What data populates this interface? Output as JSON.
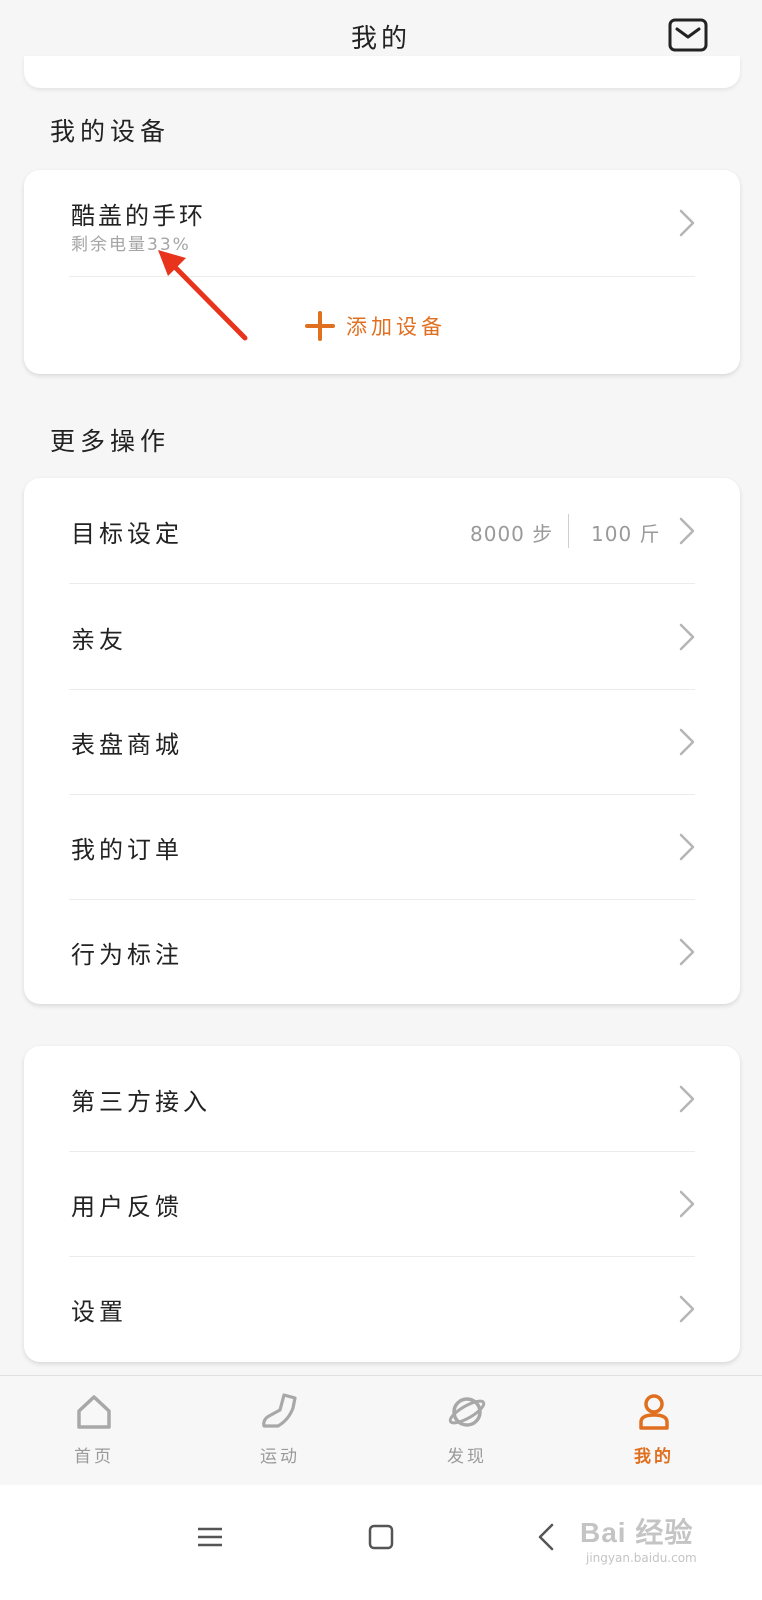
{
  "header": {
    "title": "我的",
    "mail_icon": "mail-icon"
  },
  "device_section": {
    "title": "我的设备",
    "device": {
      "name": "酷盖的手环",
      "battery_label": "剩余电量33%"
    },
    "add_label": "添加设备",
    "accent_color": "#e07020"
  },
  "more_section": {
    "title": "更多操作",
    "rows": [
      {
        "label": "目标设定",
        "steps": "8000 步",
        "weight": "100 斤"
      },
      {
        "label": "亲友"
      },
      {
        "label": "表盘商城"
      },
      {
        "label": "我的订单"
      },
      {
        "label": "行为标注"
      }
    ]
  },
  "extra_section": {
    "rows": [
      {
        "label": "第三方接入"
      },
      {
        "label": "用户反馈"
      },
      {
        "label": "设置"
      }
    ]
  },
  "tabbar": {
    "active_index": 3,
    "tabs": [
      {
        "label": "首页",
        "icon": "home-icon"
      },
      {
        "label": "运动",
        "icon": "shoe-icon"
      },
      {
        "label": "发现",
        "icon": "planet-icon"
      },
      {
        "label": "我的",
        "icon": "person-icon"
      }
    ]
  },
  "system_nav": {
    "menu_icon": "menu-icon",
    "home_icon": "square-icon",
    "back_icon": "back-icon"
  },
  "watermark": {
    "brand": "Bai 经验",
    "url": "jingyan.baidu.com"
  }
}
